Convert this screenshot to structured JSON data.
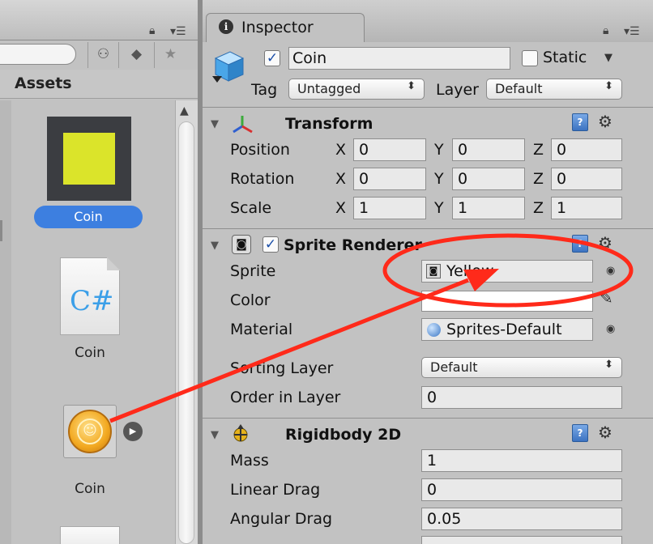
{
  "project": {
    "assets_title": "Assets",
    "assets": [
      {
        "label": "Coin",
        "icon": "sprite-yellow-square",
        "selected": true
      },
      {
        "label": "Coin",
        "icon": "csharp-script-icon",
        "script_glyph": "C#"
      },
      {
        "label": "Coin",
        "icon": "coin-prefab-icon"
      }
    ]
  },
  "inspector": {
    "tab_label": "Inspector",
    "object": {
      "name": "Coin",
      "active": true,
      "static_label": "Static",
      "static": false
    },
    "tag_label": "Tag",
    "tag_value": "Untagged",
    "layer_label": "Layer",
    "layer_value": "Default",
    "transform": {
      "title": "Transform",
      "rows": [
        {
          "label": "Position",
          "x": "0",
          "y": "0",
          "z": "0"
        },
        {
          "label": "Rotation",
          "x": "0",
          "y": "0",
          "z": "0"
        },
        {
          "label": "Scale",
          "x": "1",
          "y": "1",
          "z": "1"
        }
      ],
      "axis_x": "X",
      "axis_y": "Y",
      "axis_z": "Z"
    },
    "sprite_renderer": {
      "title": "Sprite Renderer",
      "enabled": true,
      "sprite_label": "Sprite",
      "sprite_value": "Yellow",
      "color_label": "Color",
      "color_value": "#ffffff",
      "material_label": "Material",
      "material_value": "Sprites-Default",
      "sorting_layer_label": "Sorting Layer",
      "sorting_layer_value": "Default",
      "order_label": "Order in Layer",
      "order_value": "0"
    },
    "rigidbody2d": {
      "title": "Rigidbody 2D",
      "mass_label": "Mass",
      "mass_value": "1",
      "linear_drag_label": "Linear Drag",
      "linear_drag_value": "0",
      "angular_drag_label": "Angular Drag",
      "angular_drag_value": "0.05"
    }
  },
  "annotation": {
    "color": "#ff2a1a",
    "shapes": [
      "ellipse-around-sprite-field",
      "arrow-from-coin-prefab"
    ]
  }
}
